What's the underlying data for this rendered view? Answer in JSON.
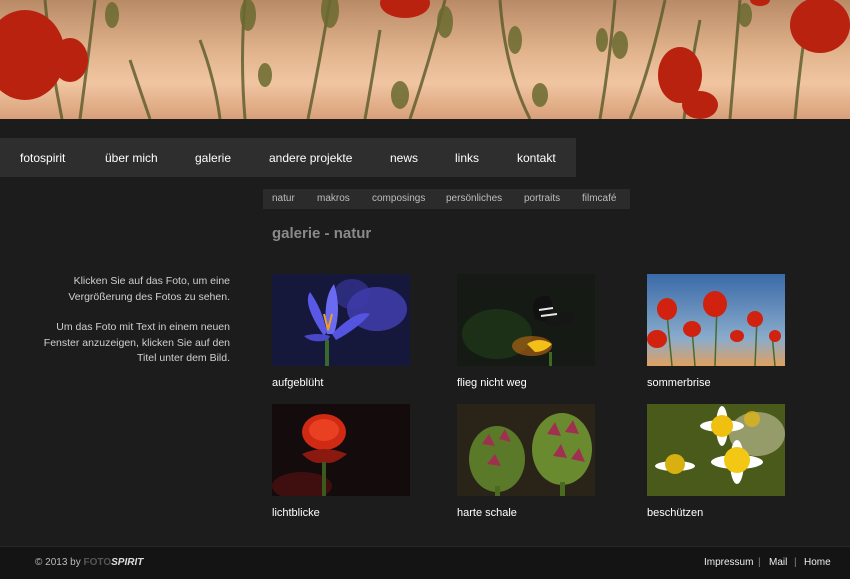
{
  "nav": {
    "items": [
      "fotospirit",
      "über mich",
      "galerie",
      "andere projekte",
      "news",
      "links",
      "kontakt"
    ]
  },
  "subnav": {
    "items": [
      "natur",
      "makros",
      "composings",
      "persönliches",
      "portraits",
      "filmcafé"
    ]
  },
  "page": {
    "title": "galerie - natur"
  },
  "info": {
    "paragraph1": "Klicken Sie auf das Foto, um eine Vergrößerung des Fotos zu sehen.",
    "paragraph2": "Um das Foto mit Text in einem neuen Fenster anzuzeigen, klicken Sie auf den Titel unter dem Bild."
  },
  "gallery": {
    "items": [
      {
        "title": "aufgeblüht",
        "icon": "crocus-photo"
      },
      {
        "title": "flieg nicht weg",
        "icon": "butterfly-photo"
      },
      {
        "title": "sommerbrise",
        "icon": "poppies-photo"
      },
      {
        "title": "lichtblicke",
        "icon": "red-flower-photo"
      },
      {
        "title": "harte schale",
        "icon": "artichoke-buds-photo"
      },
      {
        "title": "beschützen",
        "icon": "chamomile-photo"
      }
    ]
  },
  "footer": {
    "copyright_prefix": "© 2013 by",
    "brand_foto": "FOTO",
    "brand_spirit": "SPIRIT",
    "links": [
      "Impressum",
      "Mail",
      "Home"
    ],
    "separator": "|"
  },
  "colors": {
    "background": "#1c1c1c",
    "nav_bar": "#2e2e2e",
    "title_gray": "#8a8a8a"
  }
}
